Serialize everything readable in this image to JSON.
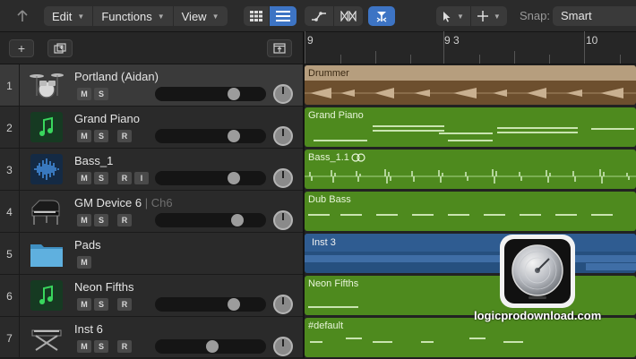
{
  "toolbar": {
    "back_icon": "up-arrow-icon",
    "menus": [
      "Edit",
      "Functions",
      "View"
    ],
    "view_buttons": [
      "grid-view-icon",
      "list-view-icon"
    ],
    "automation_buttons": [
      "automation-curve-icon",
      "flex-icon"
    ],
    "catch_button": "catch-playhead-icon",
    "tools": [
      "pointer-tool-icon",
      "crosshair-tool-icon"
    ],
    "snap_label": "Snap:",
    "snap_value": "Smart"
  },
  "header": {
    "add_icon": "plus-icon",
    "duplicate_icon": "duplicate-track-icon",
    "collapse_icon": "collapse-icon"
  },
  "ruler": {
    "labels": [
      "9",
      "9 3",
      "10"
    ]
  },
  "tracks": [
    {
      "number": "1",
      "name": "Portland (Aidan)",
      "sub": "",
      "buttons": [
        "M",
        "S"
      ],
      "icon": "drum-kit-icon",
      "volume": 0.72,
      "region": {
        "name": "Drummer",
        "color": "#b69e7e"
      }
    },
    {
      "number": "2",
      "name": "Grand Piano",
      "sub": "",
      "buttons": [
        "M",
        "S",
        "R"
      ],
      "icon": "music-note-icon",
      "volume": 0.7,
      "region": {
        "name": "Grand Piano",
        "color": "#4e8a1e"
      }
    },
    {
      "number": "3",
      "name": "Bass_1",
      "sub": "",
      "buttons": [
        "M",
        "S",
        "R",
        "I"
      ],
      "icon": "audio-waveform-icon",
      "volume": 0.7,
      "region": {
        "name": "Bass_1.1",
        "color": "#4e8a1e"
      }
    },
    {
      "number": "4",
      "name": "GM Device 6",
      "sub": " | Ch6",
      "buttons": [
        "M",
        "S",
        "R"
      ],
      "icon": "grand-piano-icon",
      "volume": 0.74,
      "region": {
        "name": "Dub Bass",
        "color": "#4e8a1e"
      }
    },
    {
      "number": "5",
      "name": "Pads",
      "sub": "",
      "buttons": [
        "M"
      ],
      "icon": "folder-icon",
      "volume": null,
      "region": {
        "name": "Inst 3",
        "color": "#26507f"
      }
    },
    {
      "number": "6",
      "name": "Neon Fifths",
      "sub": "",
      "buttons": [
        "M",
        "S",
        "R"
      ],
      "icon": "music-note-icon",
      "volume": 0.7,
      "region": {
        "name": "Neon Fifths",
        "color": "#4e8a1e"
      }
    },
    {
      "number": "7",
      "name": "Inst 6",
      "sub": "",
      "buttons": [
        "M",
        "S",
        "R"
      ],
      "icon": "keyboard-stand-icon",
      "volume": 0.5,
      "region": {
        "name": "#default",
        "color": "#4e8a1e"
      }
    }
  ],
  "logo_icon": "logic-pro-app-icon",
  "watermark": "logicprodownload.com"
}
